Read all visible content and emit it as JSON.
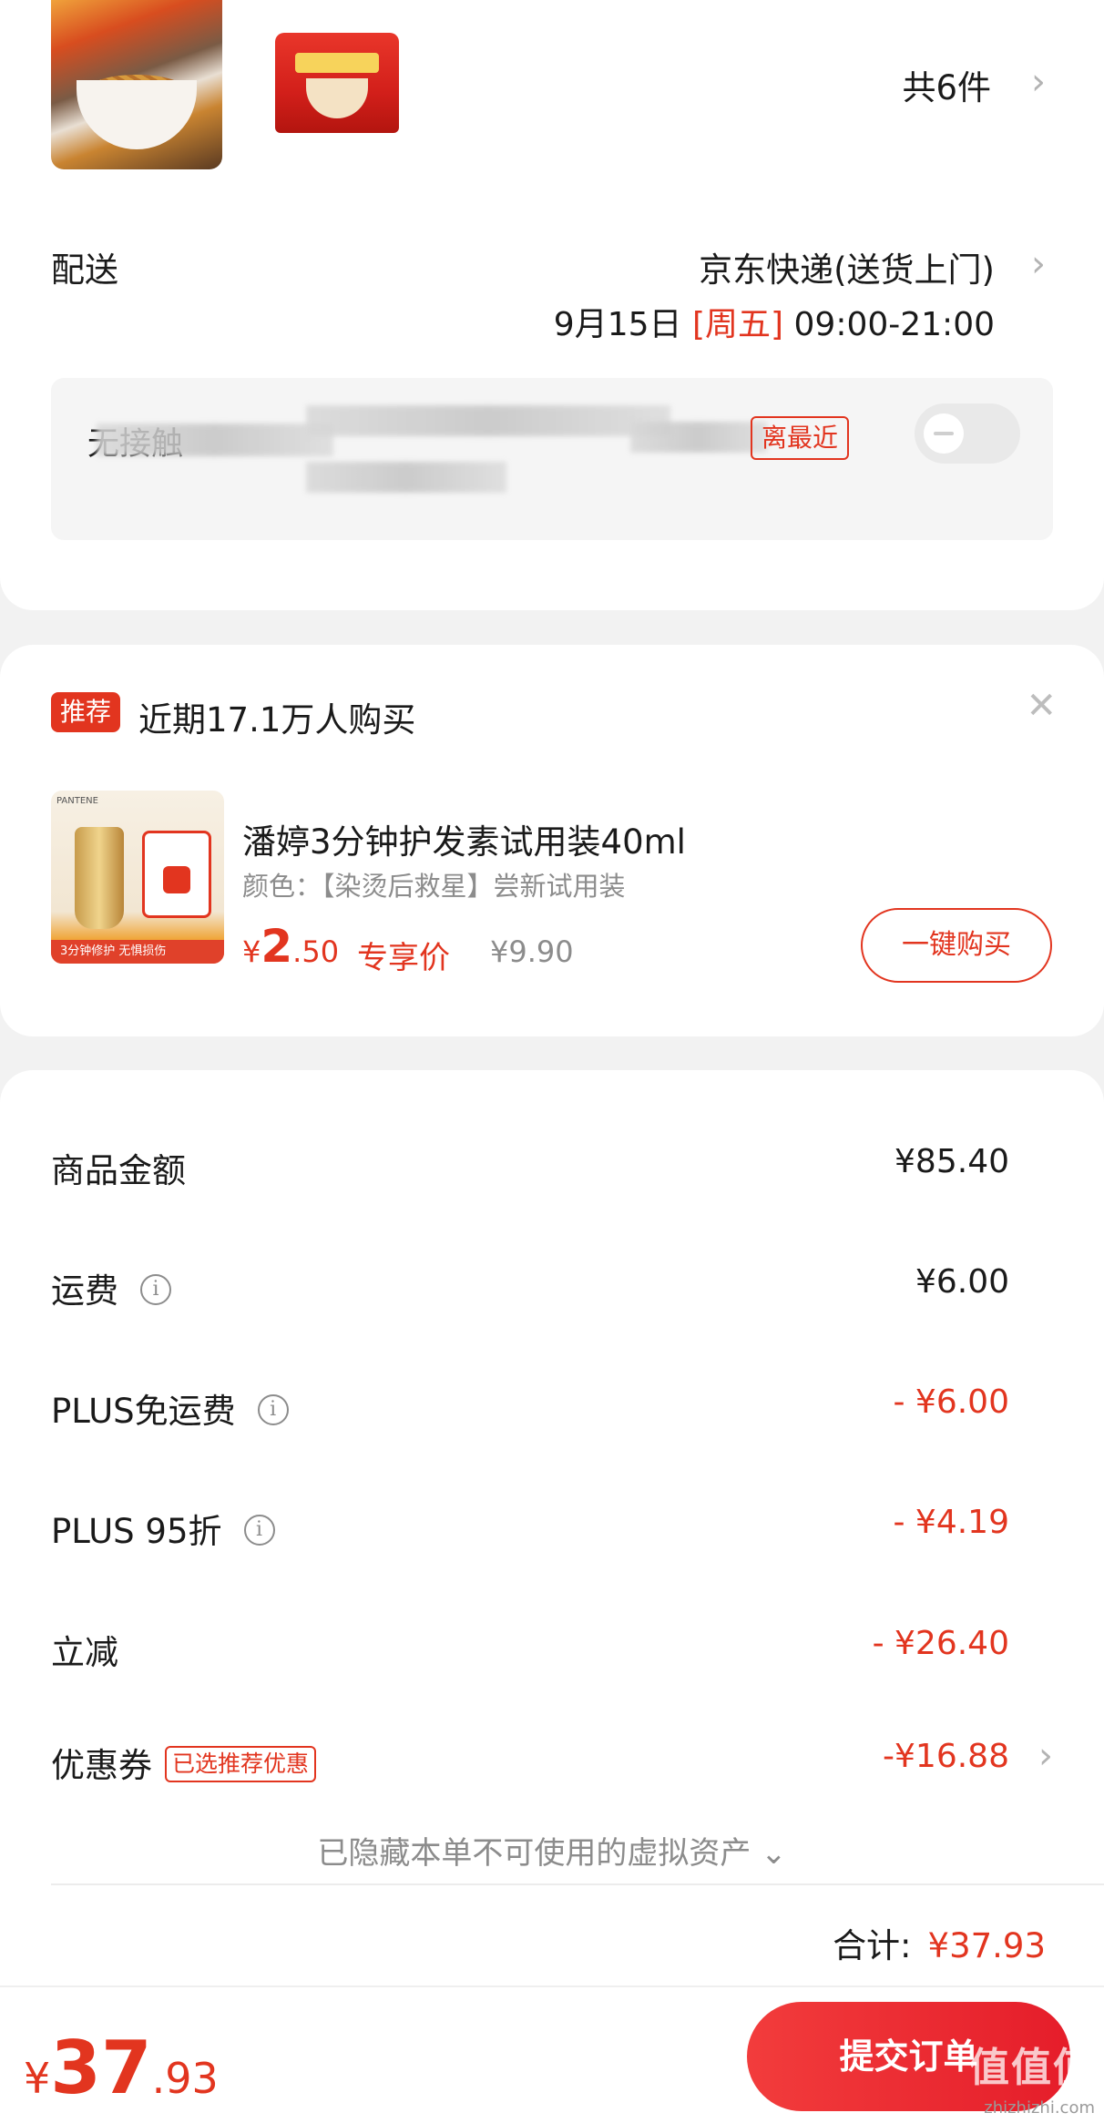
{
  "products": {
    "count_label": "共6件"
  },
  "shipping": {
    "label": "配送",
    "method": "京东快递(送货上门)",
    "date": "9月15日",
    "weekday": "[周五]",
    "time_range": "09:00-21:00",
    "contact_prefix": "无接触",
    "near_tag": "离最近"
  },
  "recommend": {
    "tag": "推荐",
    "title": "近期17.1万人购买",
    "product_name": "潘婷3分钟护发素试用装40ml",
    "spec": "颜色：【染烫后救星】尝新试用装",
    "price_currency": "¥",
    "price_int": "2",
    "price_dec": ".50",
    "exclusive_label": "专享价",
    "original_price": "¥9.90",
    "buy_label": "一键购买",
    "image_brand": "PANTENE",
    "image_strip": "3分钟修护  无惧损伤"
  },
  "summary": {
    "rows": [
      {
        "label": "商品金额",
        "value": "¥85.40"
      },
      {
        "label": "运费",
        "value": "¥6.00"
      },
      {
        "label": "PLUS免运费",
        "value": "- ¥6.00"
      },
      {
        "label": "PLUS 95折",
        "value": "- ¥4.19"
      },
      {
        "label": "立减",
        "value": "- ¥26.40"
      },
      {
        "label": "优惠券",
        "tag": "已选推荐优惠",
        "value": "-¥16.88"
      }
    ],
    "hidden_assets": "已隐藏本单不可使用的虚拟资产 ⌄",
    "total_label": "合计:",
    "total_value": "¥37.93"
  },
  "bottom": {
    "pay_currency": "¥",
    "pay_int": "37",
    "pay_dec": ".93",
    "submit_label": "提交订单",
    "watermark": "值值值",
    "watermark_url": "zhizhizhi.com"
  },
  "colors": {
    "accent": "#e2351f",
    "background": "#f2f2f2"
  }
}
